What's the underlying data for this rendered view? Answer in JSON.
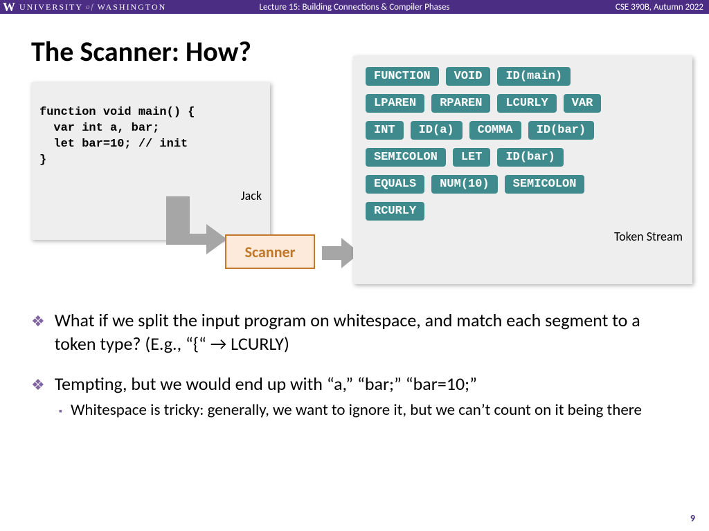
{
  "header": {
    "logo": "W",
    "university_1": "UNIVERSITY",
    "university_of": "of",
    "university_2": "WASHINGTON",
    "lecture": "Lecture 15: Building Connections & Compiler Phases",
    "course": "CSE 390B, Autumn 2022"
  },
  "title": "The Scanner: How?",
  "code": {
    "line1": "function void main() {",
    "line2": "  var int a, bar;",
    "line3": "  let bar=10; // init",
    "line4": "}",
    "lang": "Jack"
  },
  "scanner_label": "Scanner",
  "tokens": {
    "row1": [
      "FUNCTION",
      "VOID",
      "ID(main)"
    ],
    "row2": [
      "LPAREN",
      "RPAREN",
      "LCURLY",
      "VAR"
    ],
    "row3": [
      "INT",
      "ID(a)",
      "COMMA",
      "ID(bar)"
    ],
    "row4": [
      "SEMICOLON",
      "LET",
      "ID(bar)"
    ],
    "row5": [
      "EQUALS",
      "NUM(10)",
      "SEMICOLON"
    ],
    "row6": [
      "RCURLY"
    ],
    "label": "Token Stream"
  },
  "bullets": {
    "b1": "What if we split the input program on whitespace, and match each segment to a token type? (E.g., “{“ → LCURLY)",
    "b2": "Tempting, but we would end up with “a,” “bar;” “bar=10;”",
    "b2_sub": "Whitespace is tricky: generally, we want to ignore it, but we can’t count on it being there"
  },
  "pagenum": "9"
}
